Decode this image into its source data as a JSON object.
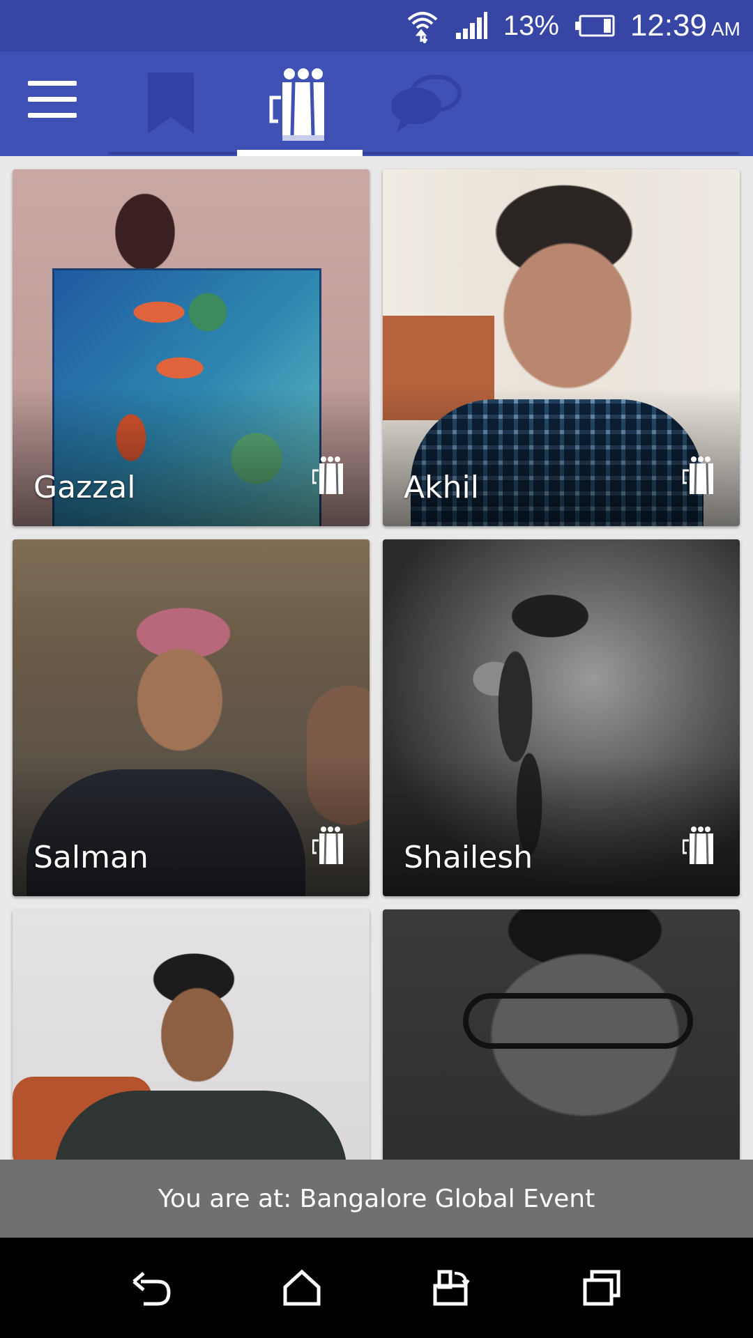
{
  "status_bar": {
    "battery_percent": "13%",
    "time": "12:39",
    "ampm": "AM",
    "icons": [
      "wifi-icon",
      "signal-icon",
      "battery-icon"
    ]
  },
  "app_bar": {
    "menu_icon": "menu-icon",
    "tabs": [
      {
        "name": "bookmarks",
        "icon": "bookmark-icon",
        "selected": false
      },
      {
        "name": "people",
        "icon": "people-icon",
        "selected": true
      },
      {
        "name": "chat",
        "icon": "chat-icon",
        "selected": false
      }
    ],
    "accent": "#3f51b5"
  },
  "people": [
    {
      "name": "Gazzal"
    },
    {
      "name": "Akhil"
    },
    {
      "name": "Salman"
    },
    {
      "name": "Shailesh"
    },
    {
      "name": ""
    },
    {
      "name": ""
    }
  ],
  "location_banner": {
    "text": "You are at: Bangalore Global Event"
  },
  "nav_bar": {
    "buttons": [
      "back-icon",
      "home-icon",
      "rotate-icon",
      "recents-icon"
    ]
  }
}
